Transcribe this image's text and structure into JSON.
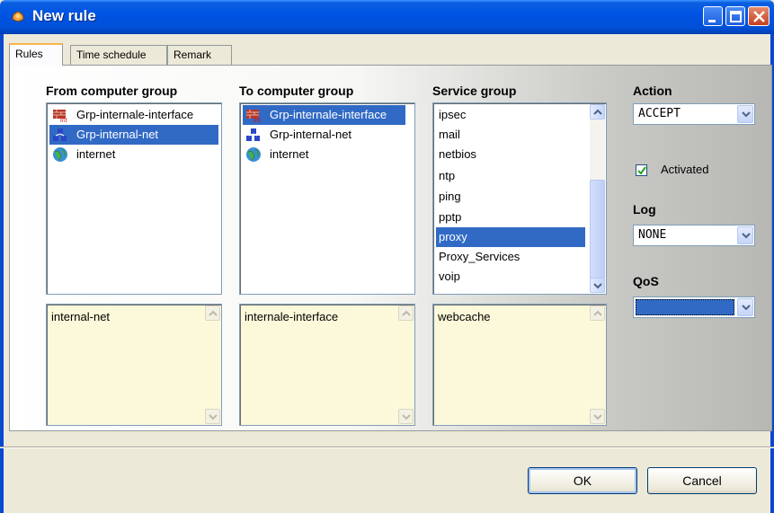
{
  "window": {
    "title": "New rule"
  },
  "tabs": [
    {
      "label": "Rules",
      "active": true
    },
    {
      "label": "Time schedule",
      "active": false
    },
    {
      "label": "Remark",
      "active": false
    }
  ],
  "from_group": {
    "label": "From computer group",
    "items": [
      {
        "label": "Grp-internale-interface",
        "icon": "firewall-interface-icon",
        "selected": false
      },
      {
        "label": "Grp-internal-net",
        "icon": "network-group-icon",
        "selected": true
      },
      {
        "label": "internet",
        "icon": "globe-icon",
        "selected": false
      }
    ],
    "memo": "internal-net"
  },
  "to_group": {
    "label": "To computer group",
    "items": [
      {
        "label": "Grp-internale-interface",
        "icon": "firewall-interface-icon",
        "selected": true
      },
      {
        "label": "Grp-internal-net",
        "icon": "network-group-icon",
        "selected": false
      },
      {
        "label": "internet",
        "icon": "globe-icon",
        "selected": false
      }
    ],
    "memo": "internale-interface"
  },
  "service_group": {
    "label": "Service group",
    "items": [
      "ipsec",
      "mail",
      "netbios",
      "ntp",
      "ping",
      "pptp",
      "proxy",
      "Proxy_Services",
      "voip"
    ],
    "selected": "proxy",
    "memo": "webcache"
  },
  "action": {
    "label": "Action",
    "value": "ACCEPT"
  },
  "activated": {
    "label": "Activated",
    "checked": true
  },
  "log": {
    "label": "Log",
    "value": "NONE"
  },
  "qos": {
    "label": "QoS",
    "value": ""
  },
  "buttons": {
    "ok": "OK",
    "cancel": "Cancel"
  }
}
